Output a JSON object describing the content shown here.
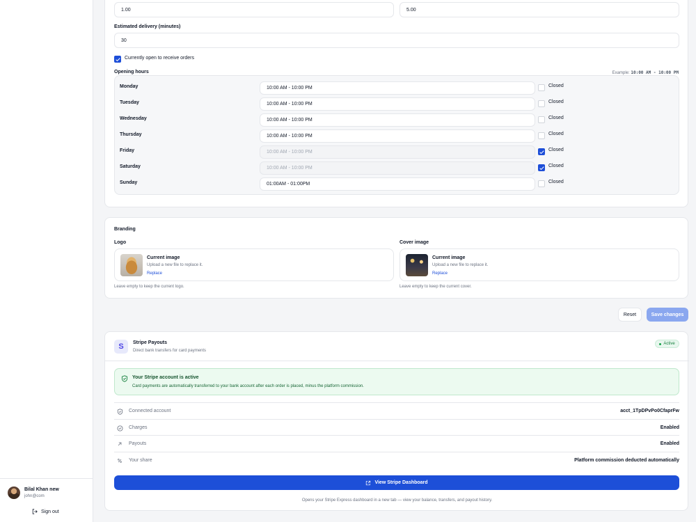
{
  "user": {
    "name": "Bilal Khan new",
    "email": "john@com",
    "sign_out": "Sign out"
  },
  "pricing": {
    "field1_value": "1.00",
    "field2_value": "5.00"
  },
  "delivery": {
    "label": "Estimated delivery (minutes)",
    "value": "30"
  },
  "open_orders": {
    "label": "Currently open to receive orders",
    "checked": true
  },
  "hours": {
    "label": "Opening hours",
    "example_prefix": "Example: ",
    "example_value": "10:00 AM - 10:00 PM",
    "closed_label": "Closed",
    "days": [
      {
        "day": "Monday",
        "time": "10:00 AM - 10:00 PM",
        "closed": false
      },
      {
        "day": "Tuesday",
        "time": "10:00 AM - 10:00 PM",
        "closed": false
      },
      {
        "day": "Wednesday",
        "time": "10:00 AM - 10:00 PM",
        "closed": false
      },
      {
        "day": "Thursday",
        "time": "10:00 AM - 10:00 PM",
        "closed": false
      },
      {
        "day": "Friday",
        "time": "10:00 AM - 10:00 PM",
        "closed": true
      },
      {
        "day": "Saturday",
        "time": "10:00 AM - 10:00 PM",
        "closed": true
      },
      {
        "day": "Sunday",
        "time": "01:00AM - 01:00PM",
        "closed": false
      }
    ]
  },
  "branding": {
    "title": "Branding",
    "logo": {
      "label": "Logo",
      "title": "Current image",
      "desc": "Upload a new file to replace it.",
      "link": "Replace",
      "hint": "Leave empty to keep the current logo."
    },
    "cover": {
      "label": "Cover image",
      "title": "Current image",
      "desc": "Upload a new file to replace it.",
      "link": "Replace",
      "hint": "Leave empty to keep the current cover."
    }
  },
  "actions": {
    "reset": "Reset",
    "save": "Save changes"
  },
  "stripe": {
    "logo_letter": "S",
    "title": "Stripe Payouts",
    "subtitle": "Direct bank transfers for card payments",
    "status": "Active",
    "alert_title": "Your Stripe account is active",
    "alert_desc": "Card payments are automatically transferred to your bank account after each order is placed, minus the platform commission.",
    "rows": [
      {
        "icon": "shield-icon",
        "label": "Connected account",
        "value": "acct_1TpDPvPo0CfaprFw"
      },
      {
        "icon": "check-circle-icon",
        "label": "Charges",
        "value": "Enabled"
      },
      {
        "icon": "arrow-up-right-icon",
        "label": "Payouts",
        "value": "Enabled"
      },
      {
        "icon": "percent-icon",
        "label": "Your share",
        "value": "Platform commission deducted automatically"
      }
    ],
    "dashboard_button": "View Stripe Dashboard",
    "dashboard_note": "Opens your Stripe Express dashboard in a new tab — view your balance, transfers, and payout history."
  },
  "colors": {
    "primary": "#1d4ed8",
    "success": "#16a34a"
  }
}
